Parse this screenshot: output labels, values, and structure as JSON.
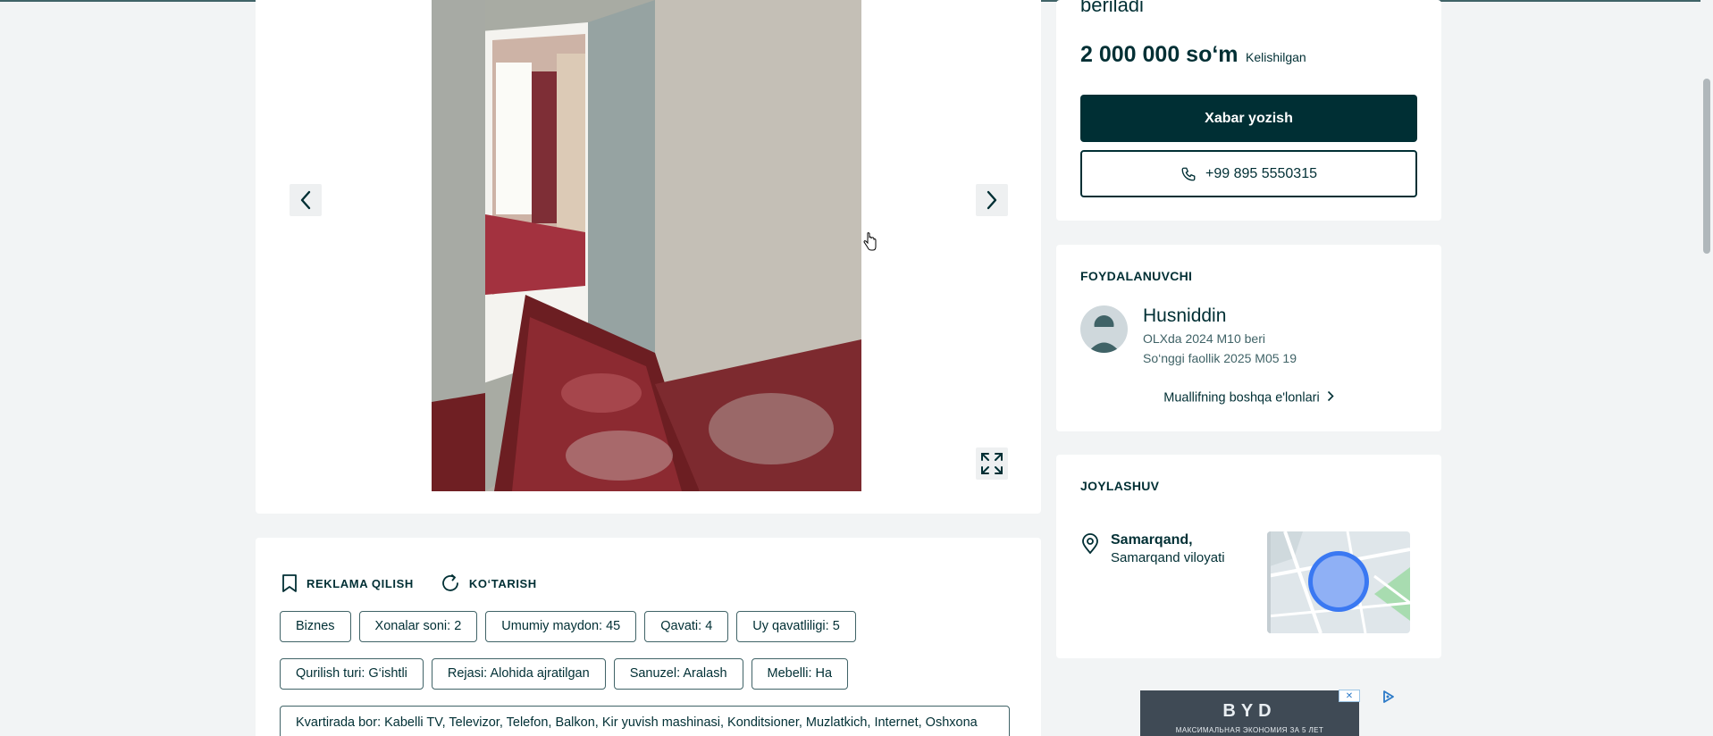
{
  "gallery": {
    "prev_icon": "chevron-left-icon",
    "next_icon": "chevron-right-icon",
    "expand_icon": "fullscreen-icon"
  },
  "actions": {
    "promote_label": "REKLAMA QILISH",
    "promote_icon": "bookmark-icon",
    "raise_label": "KO‘TARISH",
    "raise_icon": "refresh-icon"
  },
  "tags": {
    "row1": [
      "Biznes",
      "Xonalar soni: 2",
      "Umumiy maydon: 45",
      "Qavati: 4",
      "Uy qavatliligi: 5"
    ],
    "row2": [
      "Qurilish turi: G‘ishtli",
      "Rejasi: Alohida ajratilgan",
      "Sanuzel: Aralash",
      "Mebelli: Ha"
    ]
  },
  "features_text": "Kvartirada bor: Kabelli TV, Televizor, Telefon, Balkon, Kir yuvish mashinasi, Konditsioner, Muzlatkich, Internet, Oshxona",
  "listing": {
    "title_tail": "beriladi",
    "price": "2 000 000 so‘m",
    "negotiable": "Kelishilgan",
    "message_button": "Xabar yozish",
    "phone_button": "+99 895 5550315"
  },
  "user": {
    "section_title": "FOYDALANUVCHI",
    "name": "Husniddin",
    "member_since": "OLXda 2024 M10 beri",
    "last_seen": "So‘nggi faollik 2025 M05 19",
    "other_ads": "Muallifning boshqa e'lonlari"
  },
  "location": {
    "section_title": "JOYLASHUV",
    "city": "Samarqand,",
    "region": "Samarqand viloyati"
  },
  "ad": {
    "brand": "BYD",
    "tagline": "МАКСИМАЛЬНАЯ ЭКОНОМИЯ ЗА 5 ЛЕТ",
    "close_label": "✕"
  },
  "colors": {
    "primary": "#002f34",
    "background": "#f2f4f5",
    "tag_border": "#406367",
    "map_marker": "#3a78f2"
  }
}
